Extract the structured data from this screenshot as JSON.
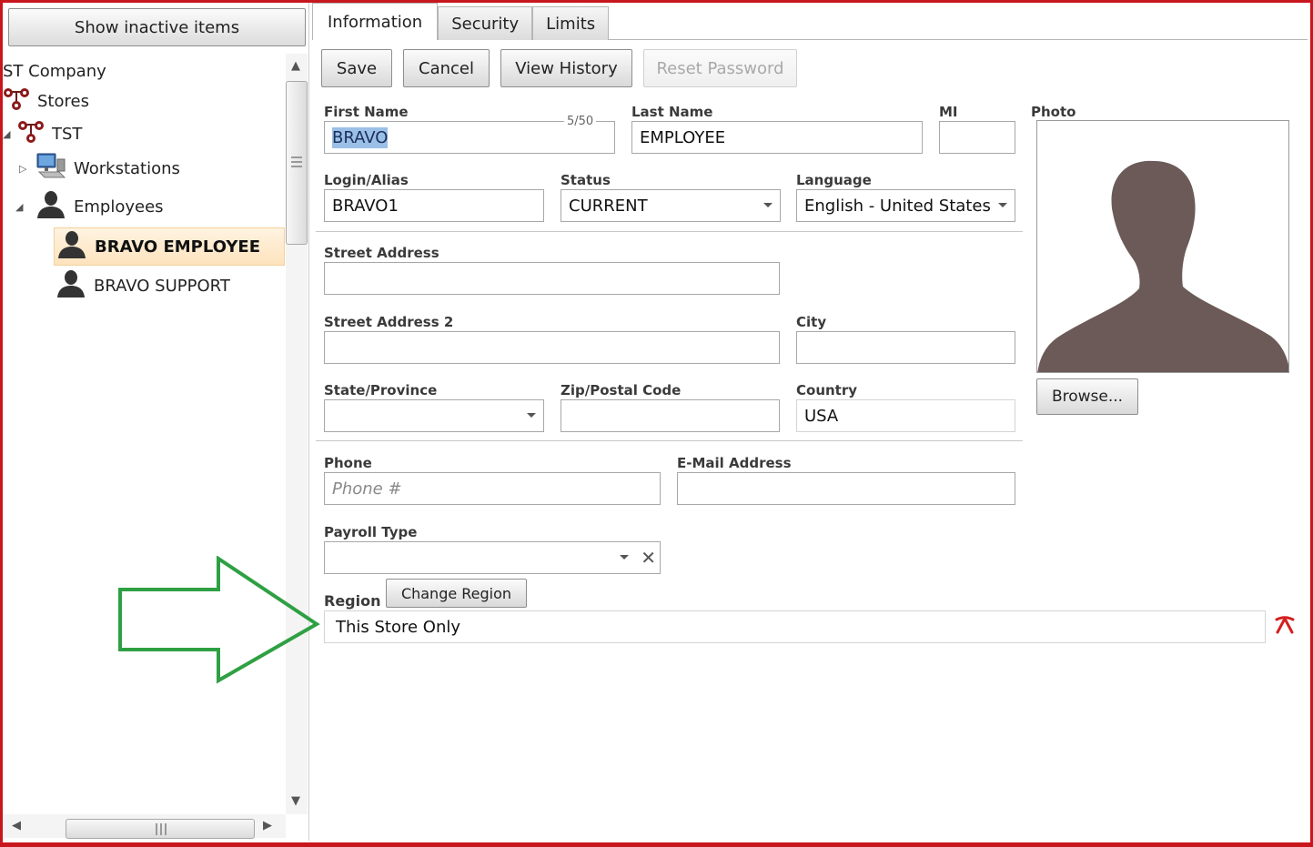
{
  "left_panel": {
    "inactive_button": "Show inactive items",
    "tree": [
      {
        "label": "ST Company",
        "icon": "company-icon"
      },
      {
        "label": "Stores",
        "icon": "stores-icon"
      },
      {
        "label": "TST",
        "icon": "store-icon"
      },
      {
        "label": "Workstations",
        "icon": "computer-icon"
      },
      {
        "label": "Employees",
        "icon": "person-icon"
      },
      {
        "label": "BRAVO EMPLOYEE",
        "icon": "person-icon",
        "selected": true
      },
      {
        "label": "BRAVO SUPPORT",
        "icon": "person-icon"
      }
    ]
  },
  "tabs": [
    {
      "label": "Information",
      "active": true
    },
    {
      "label": "Security"
    },
    {
      "label": "Limits"
    }
  ],
  "toolbar": {
    "save": "Save",
    "cancel": "Cancel",
    "view_history": "View History",
    "reset_password": "Reset Password"
  },
  "form": {
    "first_name": {
      "label": "First Name",
      "value": "BRAVO",
      "counter": "5/50"
    },
    "last_name": {
      "label": "Last Name",
      "value": "EMPLOYEE"
    },
    "mi": {
      "label": "MI",
      "value": ""
    },
    "photo": {
      "label": "Photo",
      "browse": "Browse..."
    },
    "login": {
      "label": "Login/Alias",
      "value": "BRAVO1"
    },
    "status": {
      "label": "Status",
      "value": "CURRENT"
    },
    "language": {
      "label": "Language",
      "value": "English - United States"
    },
    "street": {
      "label": "Street Address",
      "value": ""
    },
    "street2": {
      "label": "Street Address 2",
      "value": ""
    },
    "city": {
      "label": "City",
      "value": ""
    },
    "state": {
      "label": "State/Province",
      "value": ""
    },
    "zip": {
      "label": "Zip/Postal Code",
      "value": ""
    },
    "country": {
      "label": "Country",
      "value": "USA"
    },
    "phone": {
      "label": "Phone",
      "placeholder": "Phone #"
    },
    "email": {
      "label": "E-Mail Address",
      "value": ""
    },
    "payroll": {
      "label": "Payroll Type",
      "value": ""
    },
    "region": {
      "label": "Region",
      "change_button": "Change Region",
      "value": "This Store Only"
    }
  },
  "colors": {
    "frame": "#c8161d",
    "arrow": "#2ea043",
    "region_clear": "#d42020",
    "selection": "#9bc0e8"
  }
}
